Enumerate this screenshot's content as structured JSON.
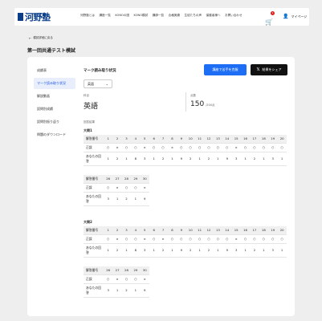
{
  "header": {
    "logo": "河野塾",
    "nav": [
      "河野塾とは",
      "講座一覧",
      "KONOの図",
      "KONO模試",
      "講師一覧",
      "合格実績",
      "生徒たちの声",
      "保護者様へ",
      "お問い合わせ"
    ],
    "cart_count": "1",
    "mypage": "マイページ"
  },
  "back": "模試詳細に戻る",
  "page_title": "第一回共通テスト模試",
  "sidebar": [
    "成績表",
    "マーク読み取り状況",
    "解説動画",
    "設問別成績",
    "設問別振り返り",
    "問題のダウンロード"
  ],
  "main": {
    "section_title": "マーク読み取り状況",
    "btn_lecture": "講座で苦手を克服",
    "btn_share": "結果をシェア",
    "select_value": "英語",
    "subject_label": "科目",
    "subject_value": "英語",
    "score_label": "点数",
    "score_value": "150",
    "score_unit": "/200点",
    "detail_label": "回答結果"
  },
  "questions": [
    {
      "title": "大問1",
      "header_label": "解答番号",
      "correct_label": "正誤",
      "answer_label": "あなたの回答",
      "row1": {
        "nums": [
          "1",
          "2",
          "3",
          "4",
          "5",
          "6",
          "7",
          "8",
          "9",
          "10",
          "11",
          "12",
          "13",
          "14",
          "15",
          "16",
          "17",
          "18",
          "19",
          "20"
        ],
        "marks": [
          "○",
          "×",
          "○",
          "○",
          "×",
          "○",
          "○",
          "×",
          "○",
          "○",
          "○",
          "○",
          "○",
          "○",
          "×",
          "○",
          "○",
          "○",
          "○",
          "○"
        ],
        "answers": [
          "1",
          "2",
          "1",
          "8",
          "3",
          "1",
          "2",
          "1",
          "9",
          "2",
          "1",
          "2",
          "1",
          "9",
          "3",
          "1",
          "2",
          "1",
          "3",
          "1"
        ]
      },
      "row2": {
        "nums": [
          "26",
          "27",
          "28",
          "29",
          "30"
        ],
        "marks": [
          "○",
          "×",
          "○",
          "○",
          "×"
        ],
        "answers": [
          "3",
          "1",
          "2",
          "1",
          "9"
        ]
      }
    },
    {
      "title": "大問2",
      "header_label": "解答番号",
      "correct_label": "正誤",
      "answer_label": "あなたの回答",
      "row1": {
        "nums": [
          "1",
          "2",
          "3",
          "4",
          "5",
          "6",
          "7",
          "8",
          "9",
          "10",
          "11",
          "12",
          "13",
          "14",
          "15",
          "16",
          "17",
          "18",
          "19",
          "20"
        ],
        "marks": [
          "○",
          "×",
          "○",
          "○",
          "×",
          "○",
          "×",
          "○",
          "○",
          "○",
          "○",
          "○",
          "○",
          "○",
          "×",
          "○",
          "○",
          "○",
          "○",
          "○"
        ],
        "answers": [
          "1",
          "2",
          "1",
          "8",
          "3",
          "1",
          "2",
          "1",
          "9",
          "2",
          "1",
          "2",
          "1",
          "9",
          "3",
          "1",
          "2",
          "1",
          "3",
          "1"
        ]
      },
      "row2": {
        "nums": [
          "26",
          "27",
          "28",
          "29",
          "30"
        ],
        "marks": [
          "○",
          "×",
          "○",
          "○",
          "×"
        ],
        "answers": [
          "3",
          "1",
          "2",
          "1",
          "9"
        ]
      }
    }
  ],
  "colors": {
    "accent": "#1e6ef5",
    "brand": "#0a3d8a",
    "badge": "#e02020"
  },
  "icons": {
    "cart": "cart-icon",
    "person": "person-icon",
    "back": "arrow-left-icon",
    "x": "x-logo-icon",
    "chevron": "chevron-down-icon"
  }
}
